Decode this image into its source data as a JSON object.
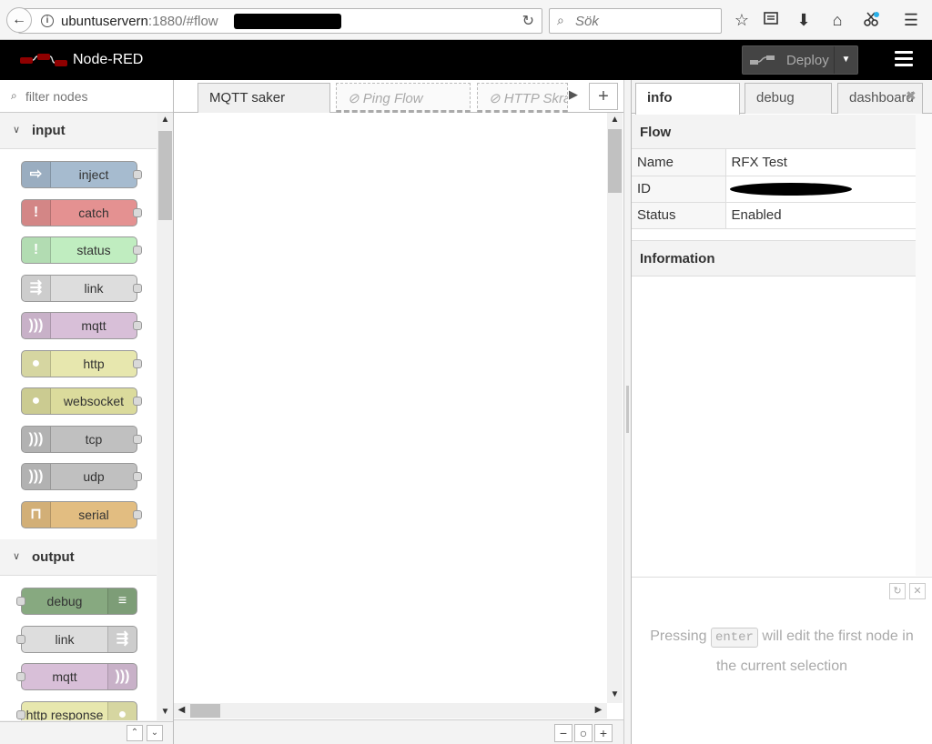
{
  "browser": {
    "url_host": "ubuntuservern",
    "url_rest": ":1880/#flow",
    "search_placeholder": "Sök"
  },
  "header": {
    "title": "Node-RED",
    "deploy_label": "Deploy"
  },
  "palette": {
    "filter_placeholder": "filter nodes",
    "categories": [
      {
        "name": "input",
        "nodes": [
          {
            "label": "inject",
            "color": "#a6bbcf",
            "icon": "arrow-in-icon"
          },
          {
            "label": "catch",
            "color": "#e49191",
            "icon": "exclamation-icon"
          },
          {
            "label": "status",
            "color": "#c0edc0",
            "icon": "exclamation-icon"
          },
          {
            "label": "link",
            "color": "#dddddd",
            "icon": "link-in-icon"
          },
          {
            "label": "mqtt",
            "color": "#d8bfd8",
            "icon": "bridge-icon"
          },
          {
            "label": "http",
            "color": "#e7e7ae",
            "icon": "globe-icon"
          },
          {
            "label": "websocket",
            "color": "#dbdb9c",
            "icon": "globe-icon"
          },
          {
            "label": "tcp",
            "color": "#c0c0c0",
            "icon": "bridge-icon"
          },
          {
            "label": "udp",
            "color": "#c0c0c0",
            "icon": "bridge-icon"
          },
          {
            "label": "serial",
            "color": "#e2bd81",
            "icon": "serial-icon"
          }
        ]
      },
      {
        "name": "output",
        "nodes": [
          {
            "label": "debug",
            "color": "#87a980",
            "icon": "debug-icon"
          },
          {
            "label": "link",
            "color": "#dddddd",
            "icon": "link-out-icon"
          },
          {
            "label": "mqtt",
            "color": "#d8bfd8",
            "icon": "bridge-icon"
          },
          {
            "label": "http response",
            "color": "#e7e7ae",
            "icon": "globe-icon"
          }
        ]
      }
    ]
  },
  "workspace": {
    "tabs": [
      {
        "label": "MQTT saker",
        "disabled": false
      },
      {
        "label": "Ping Flow",
        "disabled": true
      },
      {
        "label": "HTTP Skrap",
        "disabled": true
      }
    ]
  },
  "sidebar": {
    "tabs": [
      {
        "label": "info"
      },
      {
        "label": "debug"
      },
      {
        "label": "dashboard"
      }
    ],
    "flow_section_title": "Flow",
    "rows": [
      {
        "key": "Name",
        "value": "RFX Test"
      },
      {
        "key": "ID",
        "value": ""
      },
      {
        "key": "Status",
        "value": "Enabled"
      }
    ],
    "information_title": "Information",
    "tip_before": "Pressing",
    "tip_key": "enter",
    "tip_after": "will edit the first node in the current selection"
  }
}
